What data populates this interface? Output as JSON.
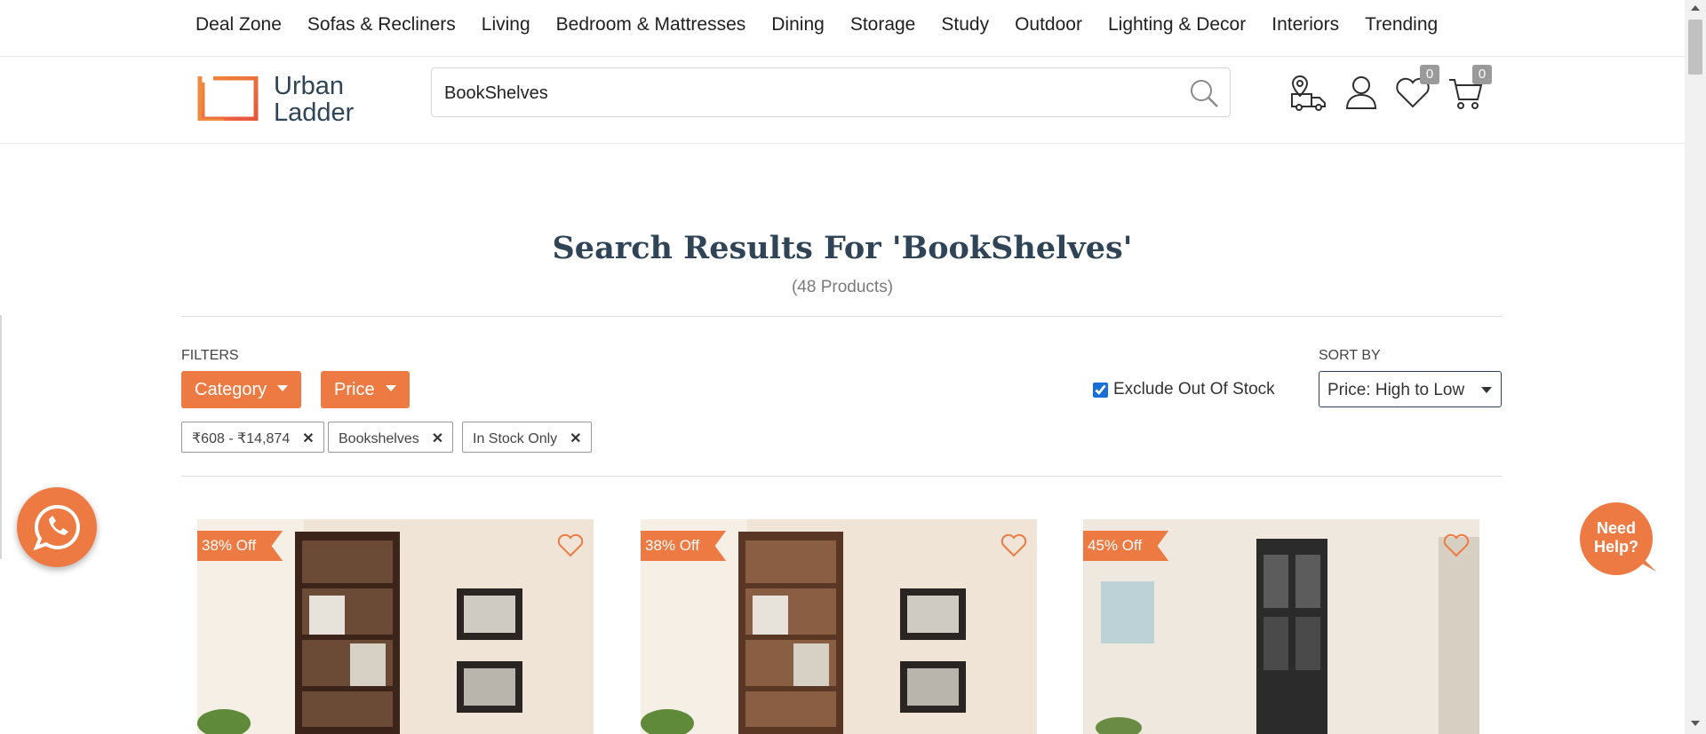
{
  "nav": {
    "items": [
      "Deal Zone",
      "Sofas & Recliners",
      "Living",
      "Bedroom & Mattresses",
      "Dining",
      "Storage",
      "Study",
      "Outdoor",
      "Lighting & Decor",
      "Interiors",
      "Trending"
    ]
  },
  "header": {
    "logo_line1": "Urban",
    "logo_line2": "Ladder",
    "search_value": "BookShelves",
    "wishlist_count": "0",
    "cart_count": "0"
  },
  "results": {
    "title": "Search Results For 'BookShelves'",
    "count": "(48 Products)"
  },
  "filters": {
    "label": "FILTERS",
    "buttons": [
      "Category",
      "Price"
    ],
    "chips": [
      "₹608 - ₹14,874",
      "Bookshelves",
      "In Stock Only"
    ],
    "exclude_out_of_stock_label": "Exclude Out Of Stock",
    "exclude_out_of_stock_checked": true
  },
  "sort": {
    "label": "SORT BY",
    "selected": "Price: High to Low"
  },
  "products": [
    {
      "discount": "38% Off"
    },
    {
      "discount": "38% Off"
    },
    {
      "discount": "45% Off"
    }
  ],
  "help": {
    "line1": "Need",
    "line2": "Help?"
  },
  "colors": {
    "accent": "#ee7a43",
    "heading": "#2f4457"
  }
}
